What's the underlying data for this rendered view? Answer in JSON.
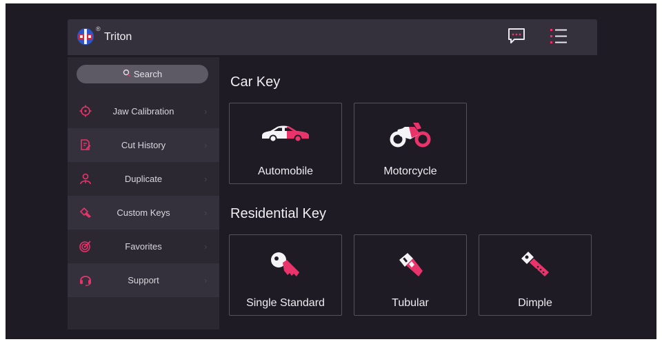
{
  "app": {
    "title": "Triton",
    "registered": "®"
  },
  "colors": {
    "accent": "#e8336b",
    "background": "#1e1b24",
    "panel": "#2b2832"
  },
  "header": {
    "message_icon": "chat-icon",
    "menu_icon": "menu-list-icon"
  },
  "search": {
    "label": "Search"
  },
  "sidebar": {
    "items": [
      {
        "label": "Jaw Calibration",
        "icon": "crosshair-icon"
      },
      {
        "label": "Cut History",
        "icon": "edit-document-icon"
      },
      {
        "label": "Duplicate",
        "icon": "person-key-icon"
      },
      {
        "label": "Custom Keys",
        "icon": "custom-key-icon"
      },
      {
        "label": "Favorites",
        "icon": "target-icon"
      },
      {
        "label": "Support",
        "icon": "headset-icon"
      }
    ]
  },
  "sections": {
    "car": {
      "title": "Car Key",
      "cards": [
        {
          "label": "Automobile",
          "icon": "car-icon"
        },
        {
          "label": "Motorcycle",
          "icon": "motorcycle-icon"
        }
      ]
    },
    "residential": {
      "title": "Residential Key",
      "cards": [
        {
          "label": "Single Standard",
          "icon": "standard-key-icon"
        },
        {
          "label": "Tubular",
          "icon": "tubular-key-icon"
        },
        {
          "label": "Dimple",
          "icon": "dimple-key-icon"
        }
      ]
    }
  }
}
